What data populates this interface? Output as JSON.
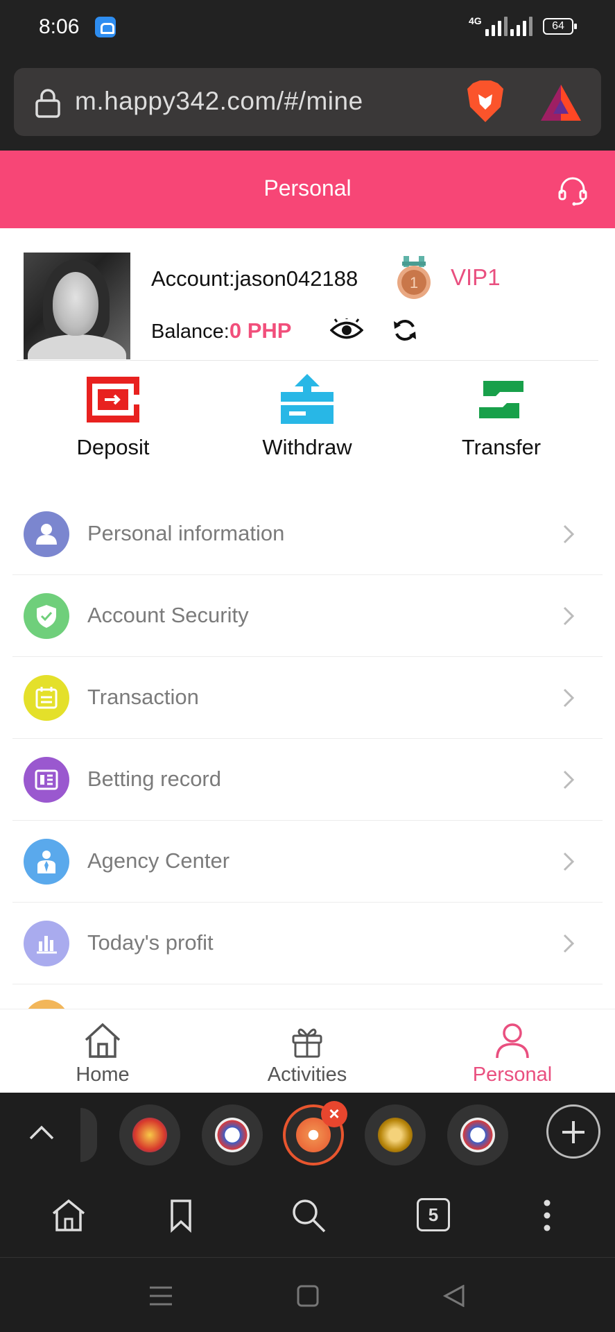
{
  "status_bar": {
    "time": "8:06",
    "network": "4G",
    "battery": "64"
  },
  "browser": {
    "url": "m.happy342.com/#/mine"
  },
  "header": {
    "title": "Personal"
  },
  "profile": {
    "account_label": "Account:jason042188",
    "vip_level": "VIP1",
    "balance_label": "Balance:",
    "balance_value": "0 PHP",
    "medal_number": "1"
  },
  "quick_actions": [
    {
      "label": "Deposit",
      "icon": "deposit-icon",
      "color": "#e8211f"
    },
    {
      "label": "Withdraw",
      "icon": "withdraw-icon",
      "color": "#28b7e6"
    },
    {
      "label": "Transfer",
      "icon": "transfer-icon",
      "color": "#18a04a"
    }
  ],
  "menu": [
    {
      "label": "Personal information",
      "icon": "user-icon",
      "color": "#7b86cf"
    },
    {
      "label": "Account Security",
      "icon": "shield-icon",
      "color": "#6fcf7b"
    },
    {
      "label": "Transaction",
      "icon": "calendar-icon",
      "color": "#e4e02a"
    },
    {
      "label": "Betting record",
      "icon": "record-icon",
      "color": "#9a58cf"
    },
    {
      "label": "Agency Center",
      "icon": "agent-icon",
      "color": "#5aa9ec"
    },
    {
      "label": "Today's profit",
      "icon": "chart-icon",
      "color": "#a9abee"
    }
  ],
  "bottom_nav": [
    {
      "label": "Home",
      "icon": "home-icon"
    },
    {
      "label": "Activities",
      "icon": "gift-icon"
    },
    {
      "label": "Personal",
      "icon": "person-icon",
      "active": true
    }
  ],
  "tabs": {
    "count": "5"
  },
  "colors": {
    "accent": "#f74676",
    "vip": "#e94f7f"
  }
}
